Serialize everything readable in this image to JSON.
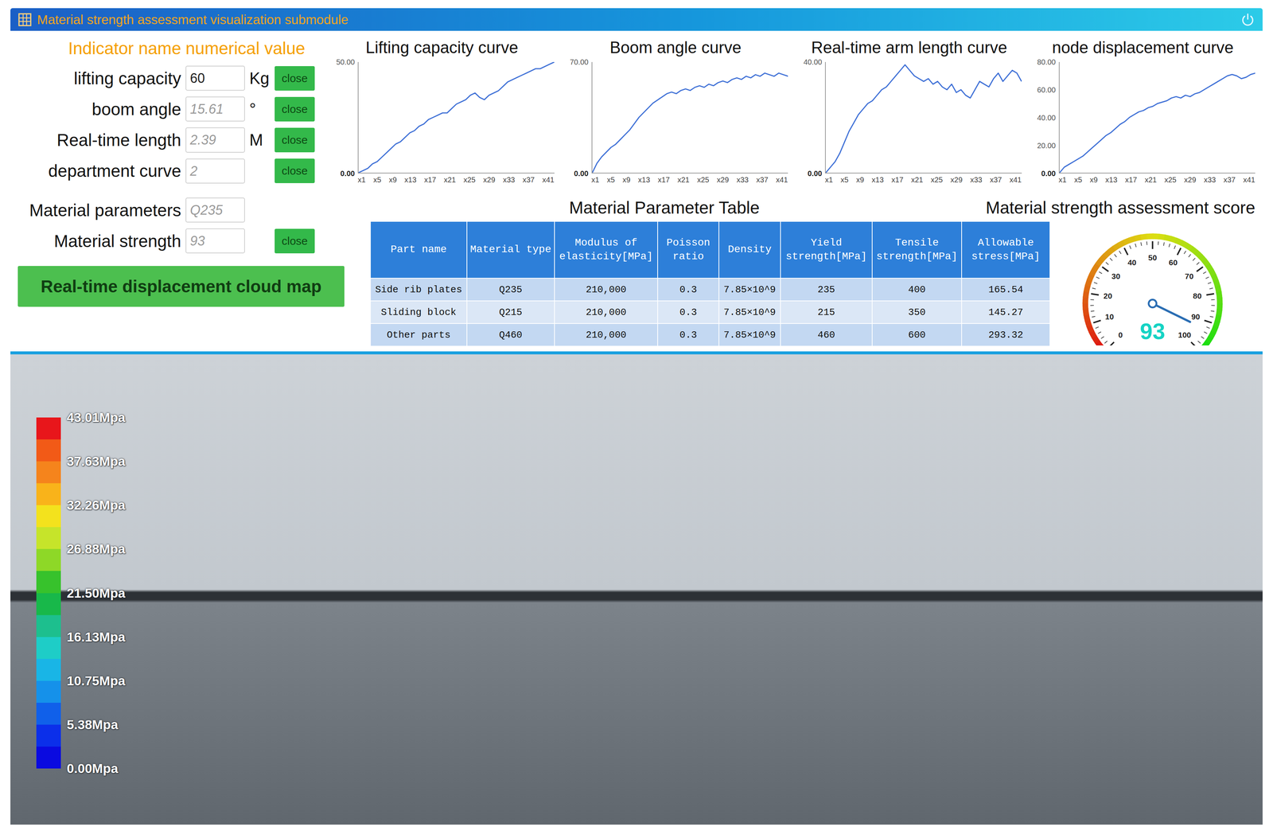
{
  "window": {
    "title": "Material strength assessment visualization submodule"
  },
  "indicators": {
    "header": {
      "name": "Indicator name",
      "value": "numerical value"
    },
    "rows": [
      {
        "label": "lifting capacity",
        "value": "60",
        "unit": "Kg",
        "greyed": false,
        "button": "close"
      },
      {
        "label": "boom angle",
        "value": "15.61",
        "unit": "°",
        "greyed": true,
        "button": "close"
      },
      {
        "label": "Real-time length",
        "value": "2.39",
        "unit": "M",
        "greyed": true,
        "button": "close"
      },
      {
        "label": "department curve",
        "value": "2",
        "unit": "",
        "greyed": true,
        "button": "close"
      }
    ]
  },
  "charts": [
    {
      "title": "Lifting capacity curve",
      "y_ticks": [
        "0.00",
        "50.00"
      ],
      "x_labels": [
        "x1",
        "x5",
        "x9",
        "x13",
        "x17",
        "x21",
        "x25",
        "x29",
        "x33",
        "x37",
        "x41"
      ],
      "values": [
        0,
        1,
        2,
        4,
        5,
        7,
        9,
        11,
        13,
        14,
        16,
        18,
        19,
        21,
        22,
        24,
        25,
        26,
        27,
        27,
        29,
        31,
        32,
        33,
        35,
        36,
        34,
        33,
        35,
        36,
        37,
        39,
        41,
        42,
        43,
        44,
        45,
        46,
        47,
        47,
        48,
        49,
        50
      ]
    },
    {
      "title": "Boom angle curve",
      "y_ticks": [
        "0.00",
        "70.00"
      ],
      "x_labels": [
        "x1",
        "x5",
        "x9",
        "x13",
        "x17",
        "x21",
        "x25",
        "x29",
        "x33",
        "x37",
        "x41"
      ],
      "values": [
        0,
        6,
        10,
        13,
        16,
        18,
        21,
        24,
        27,
        31,
        35,
        38,
        41,
        44,
        46,
        48,
        50,
        51,
        50,
        52,
        53,
        52,
        54,
        55,
        54,
        56,
        55,
        57,
        58,
        57,
        59,
        60,
        59,
        61,
        60,
        62,
        61,
        63,
        62,
        61,
        63,
        62,
        61
      ]
    },
    {
      "title": "Real-time arm length curve",
      "y_ticks": [
        "0.00",
        "40.00"
      ],
      "x_labels": [
        "x1",
        "x5",
        "x9",
        "x13",
        "x17",
        "x21",
        "x25",
        "x29",
        "x33",
        "x37",
        "x41"
      ],
      "values": [
        0,
        2,
        4,
        7,
        11,
        15,
        18,
        21,
        23,
        25,
        26,
        28,
        30,
        31,
        33,
        35,
        37,
        39,
        37,
        35,
        34,
        33,
        34,
        32,
        33,
        31,
        30,
        32,
        29,
        30,
        28,
        27,
        30,
        33,
        32,
        31,
        34,
        36,
        33,
        35,
        37,
        36,
        33
      ]
    },
    {
      "title": "node displacement curve",
      "y_ticks": [
        "0.00",
        "20.00",
        "40.00",
        "60.00",
        "80.00"
      ],
      "x_labels": [
        "x1",
        "x5",
        "x9",
        "x13",
        "x17",
        "x21",
        "x25",
        "x29",
        "x33",
        "x37",
        "x41"
      ],
      "values": [
        0,
        4,
        6,
        8,
        10,
        12,
        15,
        18,
        21,
        24,
        27,
        29,
        32,
        35,
        37,
        40,
        42,
        44,
        45,
        47,
        48,
        50,
        51,
        52,
        54,
        55,
        54,
        56,
        55,
        57,
        58,
        60,
        62,
        64,
        66,
        68,
        70,
        71,
        70,
        68,
        69,
        71,
        72
      ]
    }
  ],
  "material": {
    "rows": [
      {
        "label": "Material parameters",
        "value": "Q235",
        "greyed": true,
        "button": null
      },
      {
        "label": "Material strength",
        "value": "93",
        "greyed": true,
        "button": "close"
      }
    ],
    "cloud_button": "Real-time displacement cloud map"
  },
  "table": {
    "title": "Material Parameter Table",
    "columns": [
      "Part name",
      "Material type",
      "Modulus of elasticity[MPa]",
      "Poisson ratio",
      "Density",
      "Yield strength[MPa]",
      "Tensile strength[MPa]",
      "Allowable stress[MPa]"
    ],
    "rows": [
      [
        "Side rib plates",
        "Q235",
        "210,000",
        "0.3",
        "7.85×10^9",
        "235",
        "400",
        "165.54"
      ],
      [
        "Sliding block",
        "Q215",
        "210,000",
        "0.3",
        "7.85×10^9",
        "215",
        "350",
        "145.27"
      ],
      [
        "Other parts",
        "Q460",
        "210,000",
        "0.3",
        "7.85×10^9",
        "460",
        "600",
        "293.32"
      ]
    ]
  },
  "gauge": {
    "title": "Material strength assessment score",
    "ticks": [
      "0",
      "10",
      "20",
      "30",
      "40",
      "50",
      "60",
      "70",
      "80",
      "90",
      "100"
    ],
    "value": "93",
    "level": 0.93
  },
  "legend": {
    "labels": [
      "43.01Mpa",
      "37.63Mpa",
      "32.26Mpa",
      "26.88Mpa",
      "21.50Mpa",
      "16.13Mpa",
      "10.75Mpa",
      "5.38Mpa",
      "0.00Mpa"
    ],
    "colors": [
      "#e8161b",
      "#f25a17",
      "#f5841c",
      "#f9b31a",
      "#f3e21d",
      "#c6e42a",
      "#8ed827",
      "#37c22c",
      "#18b84a",
      "#1dbf8e",
      "#1ecdc7",
      "#19b5e6",
      "#1591ea",
      "#1060ea",
      "#0b2fea",
      "#0a0ae0"
    ]
  }
}
